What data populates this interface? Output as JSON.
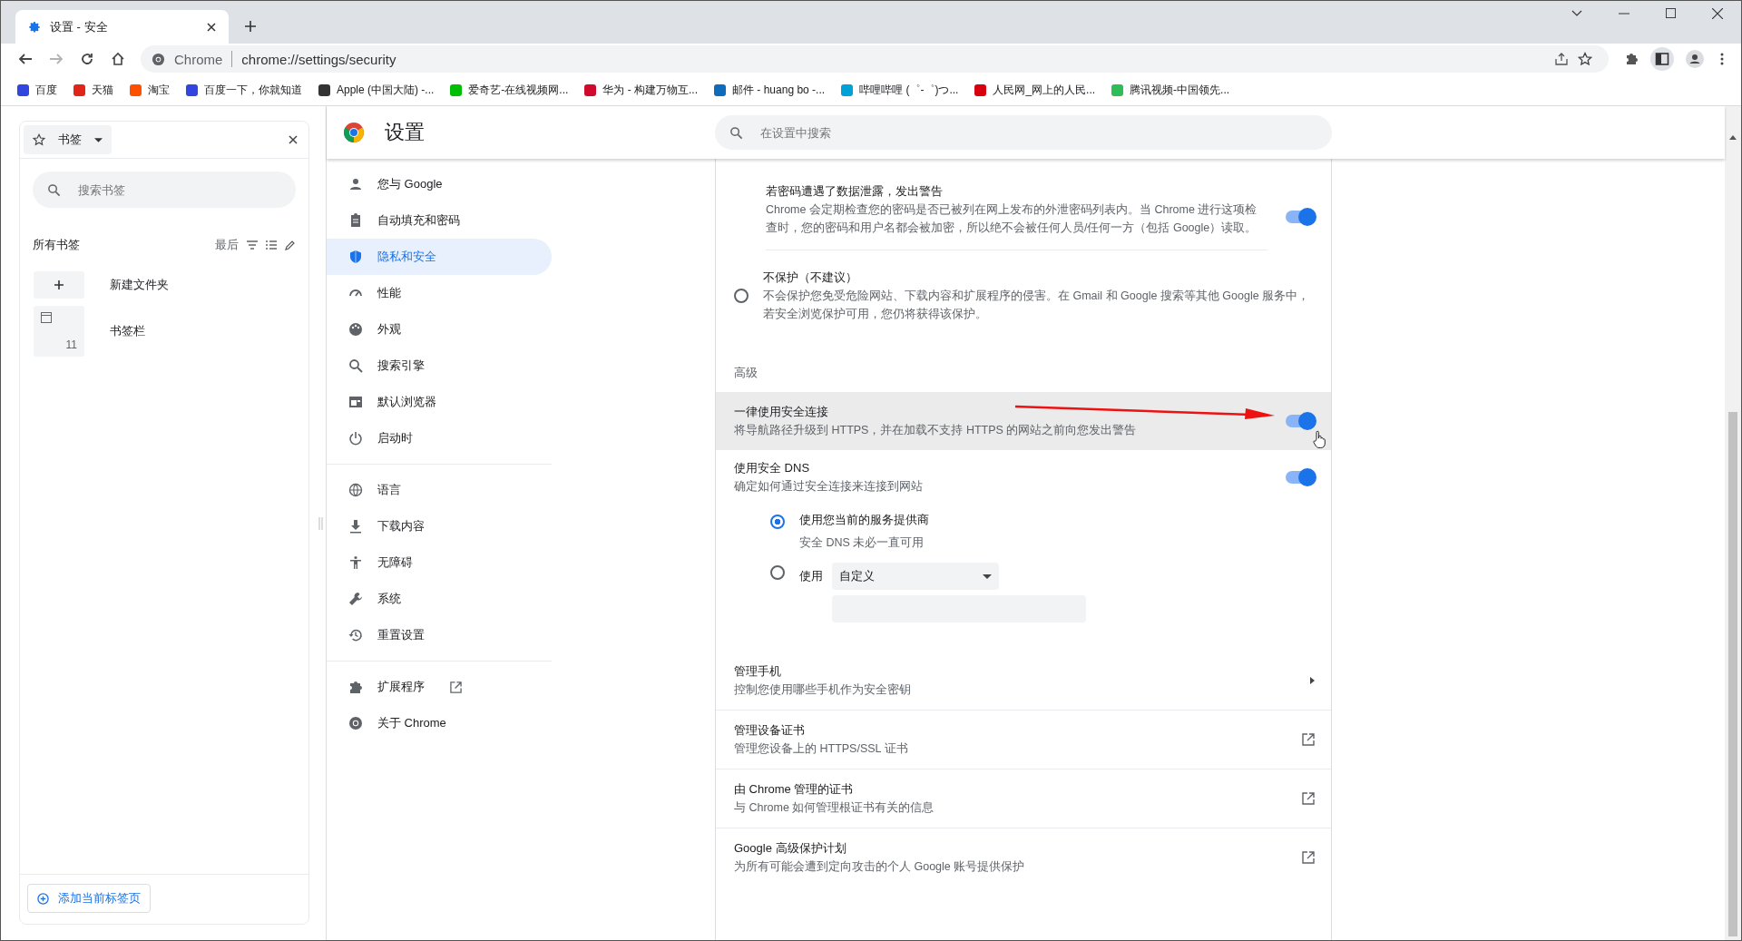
{
  "tab": {
    "title": "设置 - 安全"
  },
  "toolbar": {
    "forward_disabled": true,
    "origin": "Chrome",
    "url": "chrome://settings/security"
  },
  "bookmarks_bar": [
    {
      "label": "百度",
      "color": "#3245df"
    },
    {
      "label": "天猫",
      "color": "#e1251b"
    },
    {
      "label": "淘宝",
      "color": "#ff5000"
    },
    {
      "label": "百度一下，你就知道",
      "color": "#3245df"
    },
    {
      "label": "Apple (中国大陆) -...",
      "color": "#333333"
    },
    {
      "label": "爱奇艺-在线视频网...",
      "color": "#00be06"
    },
    {
      "label": "华为 - 构建万物互...",
      "color": "#cf0a2c"
    },
    {
      "label": "邮件 - huang bo -...",
      "color": "#0f6cbd"
    },
    {
      "label": "哔哩哔哩 (゜-゜)つ...",
      "color": "#00a1d6"
    },
    {
      "label": "人民网_网上的人民...",
      "color": "#d7000f"
    },
    {
      "label": "腾讯视频-中国领先...",
      "color": "#2ebd59"
    }
  ],
  "side_panel": {
    "title": "书签",
    "search": {
      "placeholder": "搜索书签"
    },
    "heading": "所有书签",
    "sort": "最后",
    "items": [
      {
        "kind": "new",
        "label": "新建文件夹"
      },
      {
        "kind": "folder",
        "label": "书签栏",
        "count": "11"
      }
    ],
    "add_button": "添加当前标签页"
  },
  "settings": {
    "title": "设置",
    "search": {
      "placeholder": "在设置中搜索"
    },
    "nav": [
      [
        {
          "label": "您与 Google",
          "selected": false
        },
        {
          "label": "自动填充和密码",
          "selected": false
        },
        {
          "label": "隐私和安全",
          "selected": true
        },
        {
          "label": "性能",
          "selected": false
        },
        {
          "label": "外观",
          "selected": false
        },
        {
          "label": "搜索引擎",
          "selected": false
        },
        {
          "label": "默认浏览器",
          "selected": false
        },
        {
          "label": "启动时",
          "selected": false
        }
      ],
      [
        {
          "label": "语言",
          "selected": false
        },
        {
          "label": "下载内容",
          "selected": false
        },
        {
          "label": "无障碍",
          "selected": false
        },
        {
          "label": "系统",
          "selected": false
        },
        {
          "label": "重置设置",
          "selected": false
        }
      ],
      [
        {
          "label": "扩展程序",
          "selected": false,
          "external": true
        },
        {
          "label": "关于 Chrome",
          "selected": false
        }
      ]
    ],
    "rows": [
      {
        "kind": "toggle",
        "indent": true,
        "title": "若密码遭遇了数据泄露，发出警告",
        "description": "Chrome 会定期检查您的密码是否已被列在网上发布的外泄密码列表内。当 Chrome 进行这项检查时，您的密码和用户名都会被加密，所以绝不会被任何人员/任何一方（包括 Google）读取。",
        "on": true
      },
      {
        "kind": "radio",
        "title": "不保护（不建议）",
        "description": "不会保护您免受危险网站、下载内容和扩展程序的侵害。在 Gmail 和 Google 搜索等其他 Google 服务中，若安全浏览保护可用，您仍将获得该保护。",
        "selected": false
      },
      {
        "kind": "heading",
        "title": "高级"
      },
      {
        "kind": "toggle",
        "title": "一律使用安全连接",
        "description": "将导航路径升级到 HTTPS，并在加载不支持 HTTPS 的网站之前向您发出警告",
        "on": true,
        "highlighted": true
      },
      {
        "kind": "toggle",
        "title": "使用安全 DNS",
        "description": "确定如何通过安全连接来连接到网站",
        "on": true
      },
      {
        "kind": "dns",
        "options": [
          {
            "label": "使用您当前的服务提供商",
            "sub": "安全 DNS 未必一直可用",
            "selected": true
          },
          {
            "label": "使用",
            "select": "自定义",
            "selected": false
          }
        ]
      },
      {
        "kind": "arrow",
        "title": "管理手机",
        "description": "控制您使用哪些手机作为安全密钥"
      },
      {
        "kind": "external",
        "title": "管理设备证书",
        "description": "管理您设备上的 HTTPS/SSL 证书"
      },
      {
        "kind": "external",
        "title": "由 Chrome 管理的证书",
        "description": "与 Chrome 如何管理根证书有关的信息"
      },
      {
        "kind": "external",
        "title": "Google 高级保护计划",
        "description": "为所有可能会遭到定向攻击的个人 Google 账号提供保护"
      }
    ]
  }
}
